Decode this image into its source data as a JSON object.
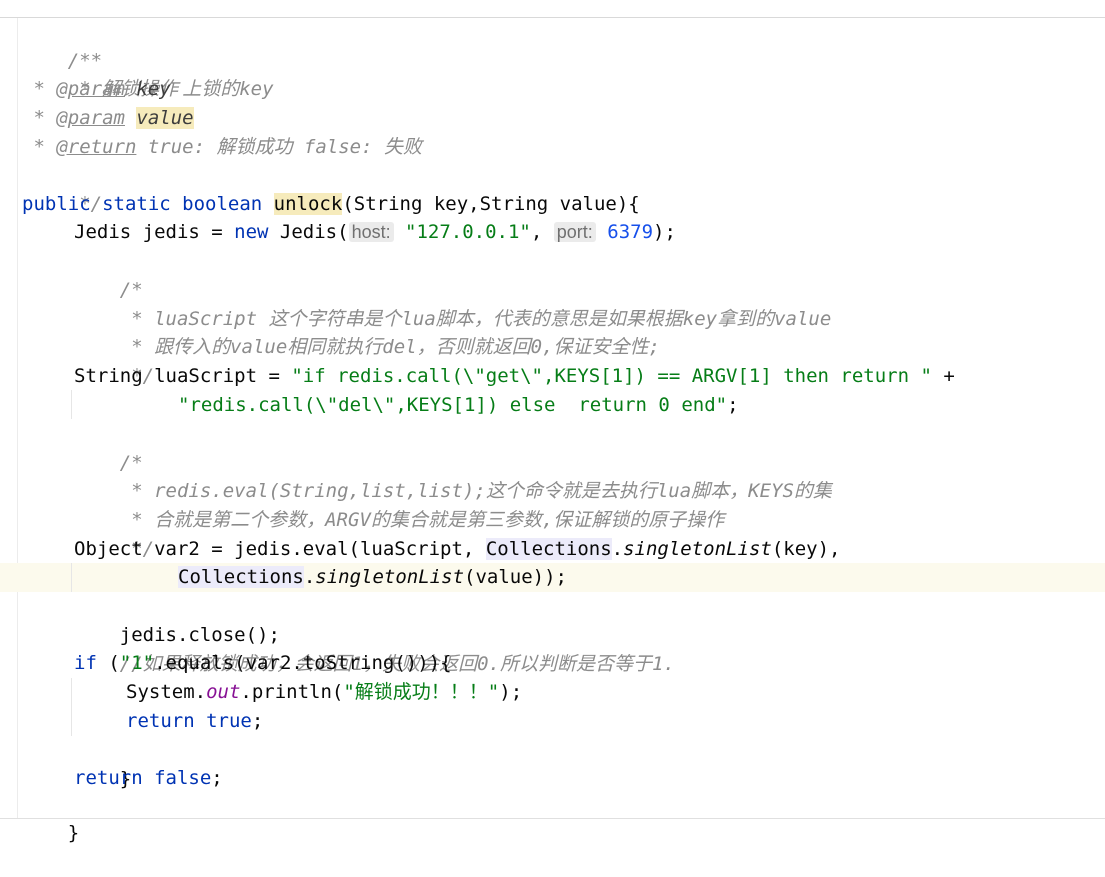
{
  "code": {
    "l01": "/**",
    "l02": " * 解锁操作",
    "l03": {
      "star": " * ",
      "tag": "@param",
      "name": "key",
      "desc": " 上锁的key"
    },
    "l04": {
      "star": " * ",
      "tag": "@param",
      "name": "value"
    },
    "l05": {
      "star": " * ",
      "tag": "@return",
      "desc": " true: 解锁成功 false: 失败"
    },
    "l06": " */",
    "l07": {
      "kw": "public static boolean ",
      "method": "unlock",
      "rest": "(String key,String value){"
    },
    "l08": {
      "a": "Jedis jedis = ",
      "kw": "new",
      "b": " Jedis(",
      "hint_host": "host:",
      "host": "\"127.0.0.1\"",
      "comma": ", ",
      "hint_port": "port:",
      "port": "6379",
      "end": ");"
    },
    "l09": "/*",
    "l10": " * luaScript 这个字符串是个lua脚本，代表的意思是如果根据key拿到的value",
    "l11": " * 跟传入的value相同就执行del，否则就返回0,保证安全性;",
    "l12": " */",
    "l13": {
      "a": "String luaScript = ",
      "str": "\"if redis.call(\\\"get\\\",KEYS[1]) == ARGV[1] then return \"",
      "b": " +"
    },
    "l14": {
      "str": "\"redis.call(\\\"del\\\",KEYS[1]) else  return 0 end\"",
      "b": ";"
    },
    "l15": "/*",
    "l16": " * redis.eval(String,list,list);这个命令就是去执行lua脚本，KEYS的集",
    "l17": " * 合就是第二个参数，ARGV的集合就是第三参数,保证解锁的原子操作",
    "l18": " */",
    "l19": {
      "a": "Object var2 = jedis.eval(luaScript, ",
      "cls": "Collections",
      "dot": ".",
      "fn": "singletonList",
      "b": "(key),"
    },
    "l20": {
      "cls": "Collections",
      "dot": ".",
      "fn": "singletonList",
      "b": "(value));"
    },
    "l21": "jedis.close();",
    "l22": "//如果释放锁成功，会返回1，失败会返回0.所以判断是否等于1.",
    "l23": {
      "kw": "if",
      "a": " (",
      "str": "\"1\"",
      "b": ".equals(var2.toString())){"
    },
    "l24": {
      "a": "System.",
      "field": "out",
      "b": ".println(",
      "str": "\"解锁成功！！！\"",
      "c": ");"
    },
    "l25": {
      "kw": "return true",
      "b": ";"
    },
    "l26": "}",
    "l27": {
      "kw": "return false",
      "b": ";"
    },
    "l28": "}"
  }
}
